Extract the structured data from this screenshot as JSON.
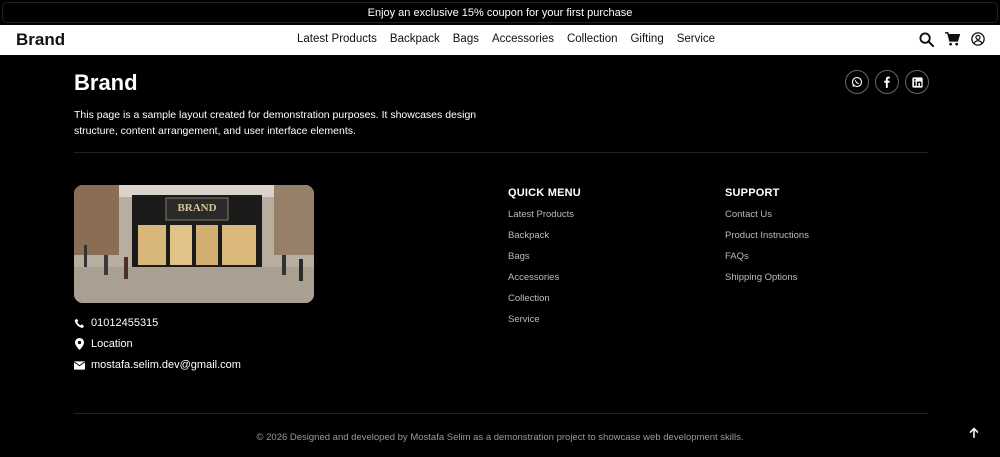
{
  "promo": {
    "text": "Enjoy an exclusive 15% coupon for your first purchase"
  },
  "nav": {
    "brand": "Brand",
    "links": [
      "Latest Products",
      "Backpack",
      "Bags",
      "Accessories",
      "Collection",
      "Gifting",
      "Service"
    ],
    "icons": [
      "search-icon",
      "cart-icon",
      "user-icon"
    ]
  },
  "footer": {
    "brand": "Brand",
    "description": "This page is a sample layout created for demonstration purposes. It showcases design structure, content arrangement, and user interface elements.",
    "socials": [
      "whatsapp-icon",
      "facebook-icon",
      "linkedin-icon"
    ],
    "store_sign": "BRAND",
    "contact": {
      "phone": "01012455315",
      "location": "Location",
      "email": "mostafa.selim.dev@gmail.com"
    },
    "quick_menu": {
      "title": "QUICK MENU",
      "items": [
        "Latest Products",
        "Backpack",
        "Bags",
        "Accessories",
        "Collection",
        "Service"
      ]
    },
    "support": {
      "title": "SUPPORT",
      "items": [
        "Contact Us",
        "Product Instructions",
        "FAQs",
        "Shipping Options"
      ]
    },
    "copyright": "© 2026 Designed and developed by Mostafa Selim as a demonstration project to showcase web development skills."
  },
  "colors": {
    "background": "#000000",
    "navbar": "#ffffff",
    "muted_text": "#bbbbbb"
  }
}
